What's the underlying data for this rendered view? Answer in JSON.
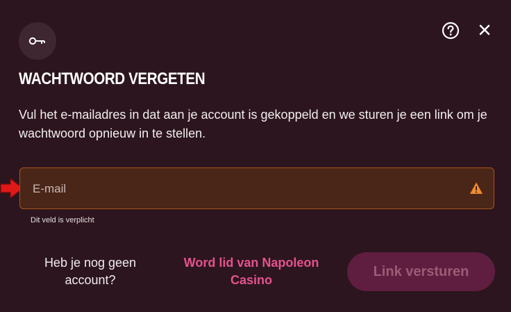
{
  "modal": {
    "title": "WACHTWOORD VERGETEN",
    "description": "Vul het e-mailadres in dat aan je account is gekoppeld en we sturen je een link om je wachtwoord opnieuw in te stellen.",
    "icons": {
      "badge": "key-icon",
      "help": "help-icon",
      "close": "close-icon",
      "field_status": "warning-icon",
      "pointer": "arrow-right-icon"
    }
  },
  "email": {
    "placeholder": "E-mail",
    "value": "",
    "error": "Dit veld is verplicht"
  },
  "footer": {
    "no_account": "Heb je nog geen account?",
    "join_link": "Word lid van Napoleon Casino",
    "submit_label": "Link versturen",
    "submit_disabled": true
  },
  "colors": {
    "background": "#2c151e",
    "accent_pink": "#e5528e",
    "warning_orange": "#f28a30",
    "field_border": "#a8551e",
    "arrow_red": "#e01818"
  }
}
